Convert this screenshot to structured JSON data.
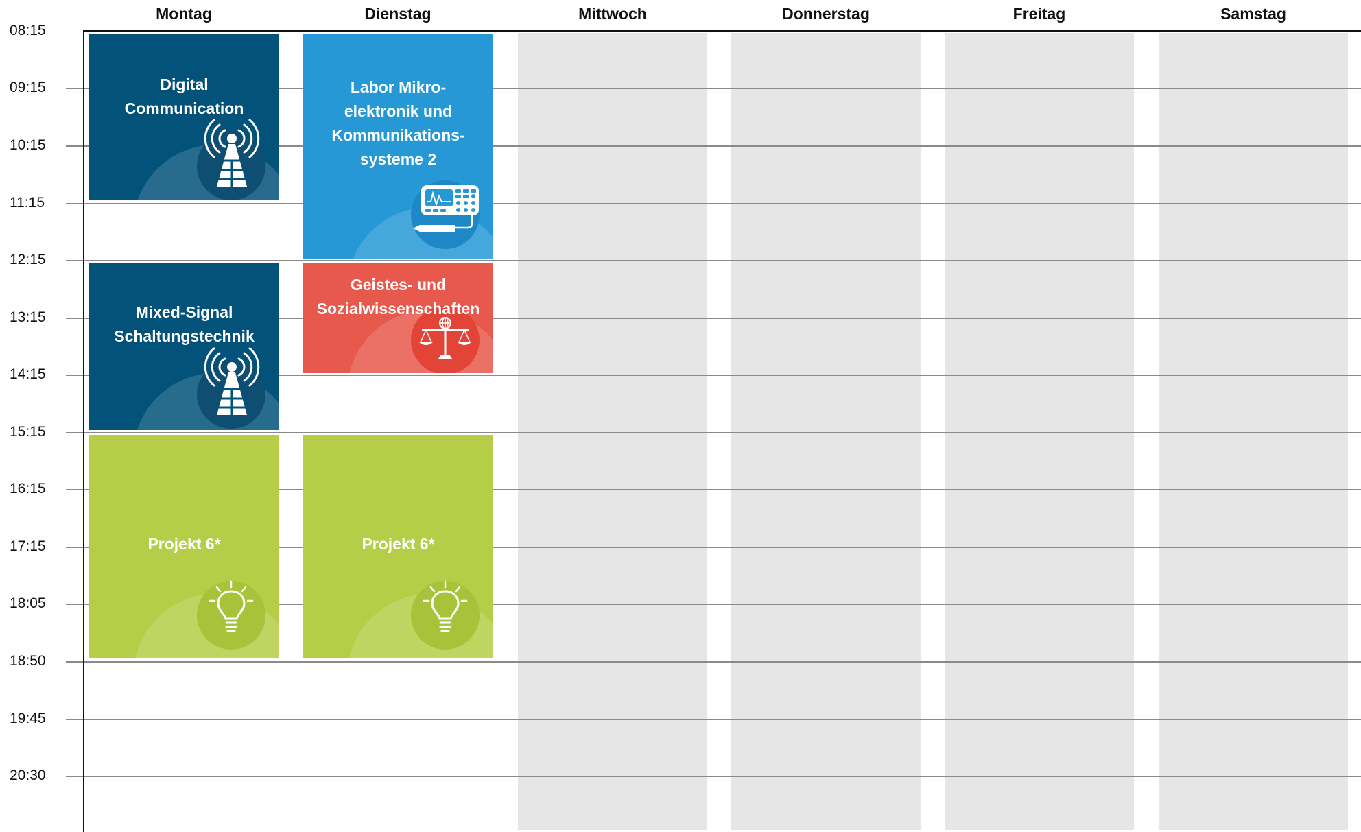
{
  "days": [
    "Montag",
    "Dienstag",
    "Mittwoch",
    "Donnerstag",
    "Freitag",
    "Samstag"
  ],
  "times": [
    "08:15",
    "09:15",
    "10:15",
    "11:15",
    "12:15",
    "13:15",
    "14:15",
    "15:15",
    "16:15",
    "17:15",
    "18:05",
    "18:50",
    "19:45",
    "20:30"
  ],
  "events": [
    {
      "title": "Digital\nCommunication",
      "color": "#02527a",
      "disc": "#0e4e72",
      "icon": "antenna-icon"
    },
    {
      "title": "Labor Mikro-\nelektronik und\nKommunikations-\nsysteme 2",
      "color": "#2598d5",
      "disc": "#1e88c6",
      "icon": "oscilloscope-icon"
    },
    {
      "title": "Mixed-Signal\nSchaltungstechnik",
      "color": "#02527a",
      "disc": "#0e4e72",
      "icon": "antenna-icon"
    },
    {
      "title": "Geistes- und\nSozialwissenschaften",
      "color": "#e8594d",
      "disc": "#e24438",
      "icon": "scales-icon"
    },
    {
      "title": "Projekt 6*",
      "color": "#b5cd47",
      "disc": "#a8c23a",
      "icon": "lightbulb-icon"
    },
    {
      "title": "Projekt 6*",
      "color": "#b5cd47",
      "disc": "#a8c23a",
      "icon": "lightbulb-icon"
    }
  ]
}
